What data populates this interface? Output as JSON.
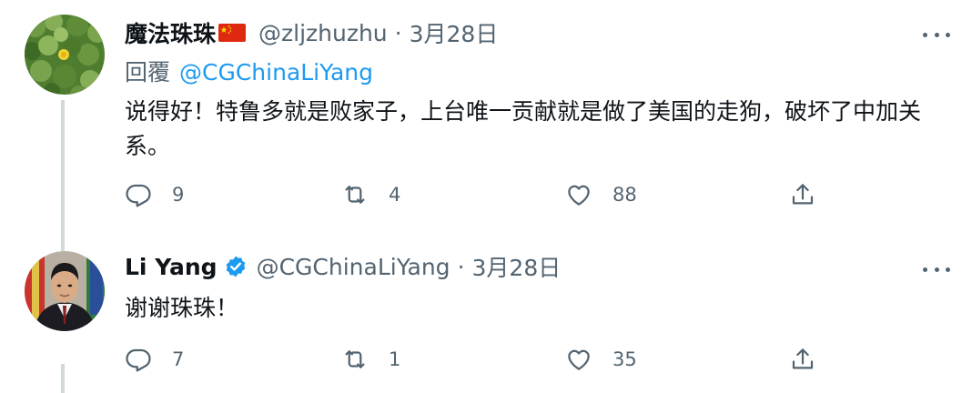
{
  "tweets": [
    {
      "display_name": "魔法珠珠",
      "flag_icon": "china-flag-icon",
      "handle": "@zljzhuzhu",
      "separator": "·",
      "date": "3月28日",
      "reply_label": "回覆",
      "reply_mention": "@CGChinaLiYang",
      "text": "说得好！特鲁多就是败家子，上台唯一贡献就是做了美国的走狗，破坏了中加关系。",
      "stats": {
        "replies": "9",
        "retweets": "4",
        "likes": "88"
      }
    },
    {
      "display_name": "Li Yang",
      "verified_icon": "verified-badge-icon",
      "handle": "@CGChinaLiYang",
      "separator": "·",
      "date": "3月28日",
      "text": "谢谢珠珠！",
      "stats": {
        "replies": "7",
        "retweets": "1",
        "likes": "35"
      }
    }
  ],
  "colors": {
    "accent": "#1d9bf0",
    "secondary_text": "#536471",
    "primary_text": "#0f1419",
    "thread_line": "#cfd9de"
  }
}
